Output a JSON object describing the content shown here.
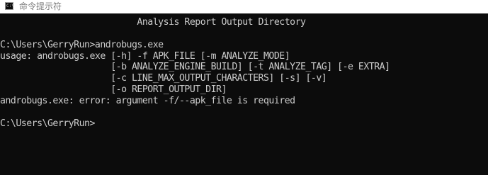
{
  "window": {
    "title": "命令提示符",
    "icon": "cmd-icon",
    "icon_glyph": "C:\\"
  },
  "console": {
    "background": "#0c0c0c",
    "text_color": "#cccccc",
    "lines": [
      "                          Analysis Report Output Directory",
      "C:\\Users\\GerryRun>androbugs.exe",
      "usage: androbugs.exe [-h] -f APK_FILE [-m ANALYZE_MODE]",
      "                     [-b ANALYZE_ENGINE_BUILD] [-t ANALYZE_TAG] [-e EXTRA]",
      "                     [-c LINE_MAX_OUTPUT_CHARACTERS] [-s] [-v]",
      "                     [-o REPORT_OUTPUT_DIR]",
      "androbugs.exe: error: argument -f/--apk_file is required",
      "C:\\Users\\GerryRun>"
    ]
  }
}
